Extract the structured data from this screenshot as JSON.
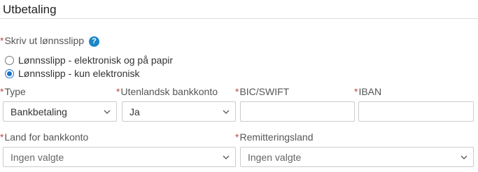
{
  "section": {
    "title": "Utbetaling"
  },
  "payslip": {
    "label": "Skriv ut lønnsslipp",
    "required_mark": "*",
    "help_icon_glyph": "?",
    "options": [
      {
        "label": "Lønnsslipp - elektronisk og på papir",
        "selected": false
      },
      {
        "label": "Lønnsslipp - kun elektronisk",
        "selected": true
      }
    ]
  },
  "fields": {
    "type": {
      "label": "Type",
      "required_mark": "*",
      "value": "Bankbetaling"
    },
    "foreign_account": {
      "label": "Utenlandsk bankkonto",
      "required_mark": "*",
      "value": "Ja"
    },
    "bic_swift": {
      "label": "BIC/SWIFT",
      "required_mark": "*",
      "value": ""
    },
    "iban": {
      "label": "IBAN",
      "required_mark": "*",
      "value": ""
    },
    "bank_country": {
      "label": "Land for bankkonto",
      "required_mark": "*",
      "value": "Ingen valgte"
    },
    "remittance_country": {
      "label": "Remitteringsland",
      "required_mark": "*",
      "value": "Ingen valgte"
    }
  },
  "colors": {
    "required": "#b94a48",
    "help_icon": "#1c87c9",
    "radio_selected": "#1a73c9",
    "field_border": "#cccccc"
  },
  "icons": {
    "help": "help-icon",
    "dropdown": "chevron-down-icon"
  }
}
